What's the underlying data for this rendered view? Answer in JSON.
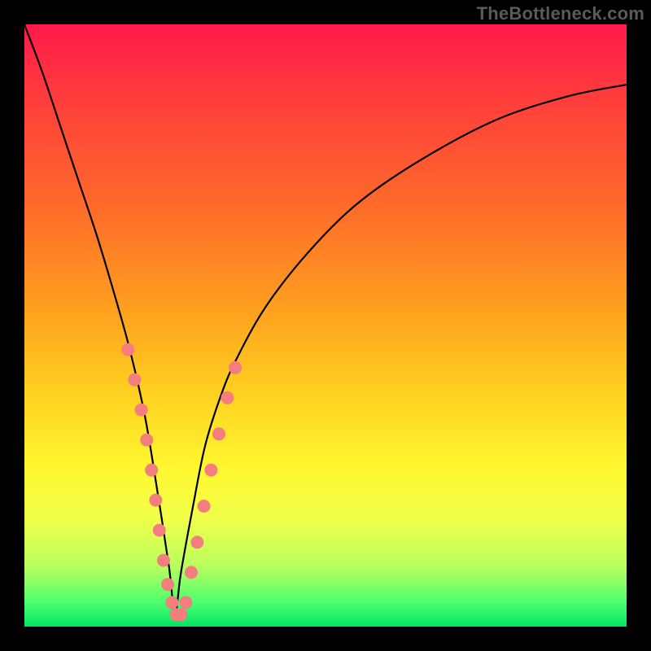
{
  "chart_data": {
    "type": "line",
    "title": "",
    "xlabel": "",
    "ylabel": "",
    "watermark": "TheBottleneck.com",
    "xlim": [
      0,
      100
    ],
    "ylim": [
      0,
      100
    ],
    "grid": false,
    "legend": false,
    "gradient_meaning": "bottom (green) = low bottleneck, top (red) = high bottleneck",
    "curve": {
      "description": "V-shaped bottleneck curve; minimum near x≈25, left branch steep to top-left corner, right branch rises toward upper-right.",
      "x": [
        0,
        3,
        6,
        9,
        12,
        15,
        17.5,
        20,
        22,
        24,
        25,
        26,
        28,
        30,
        32.5,
        35,
        40,
        47,
        55,
        65,
        78,
        90,
        100
      ],
      "y": [
        100,
        92,
        83,
        74,
        65,
        55,
        46,
        35,
        23,
        10,
        2,
        9,
        20,
        30,
        38,
        44,
        53,
        62,
        70,
        77,
        84,
        88,
        90
      ]
    },
    "markers": {
      "description": "Salmon-pink points near the trough along both branches (approx. y 10–40 range).",
      "color": "#f47d7d",
      "radius": 8,
      "points": [
        {
          "x": 17.2,
          "y": 46
        },
        {
          "x": 18.3,
          "y": 41
        },
        {
          "x": 19.4,
          "y": 36
        },
        {
          "x": 20.3,
          "y": 31
        },
        {
          "x": 21.1,
          "y": 26
        },
        {
          "x": 21.8,
          "y": 21
        },
        {
          "x": 22.4,
          "y": 16
        },
        {
          "x": 23.1,
          "y": 11
        },
        {
          "x": 23.8,
          "y": 7
        },
        {
          "x": 24.5,
          "y": 4
        },
        {
          "x": 25.2,
          "y": 2
        },
        {
          "x": 26.0,
          "y": 2
        },
        {
          "x": 26.8,
          "y": 4
        },
        {
          "x": 27.7,
          "y": 9
        },
        {
          "x": 28.7,
          "y": 14
        },
        {
          "x": 29.8,
          "y": 20
        },
        {
          "x": 31.0,
          "y": 26
        },
        {
          "x": 32.3,
          "y": 32
        },
        {
          "x": 33.7,
          "y": 38
        },
        {
          "x": 35.0,
          "y": 43
        }
      ]
    }
  }
}
